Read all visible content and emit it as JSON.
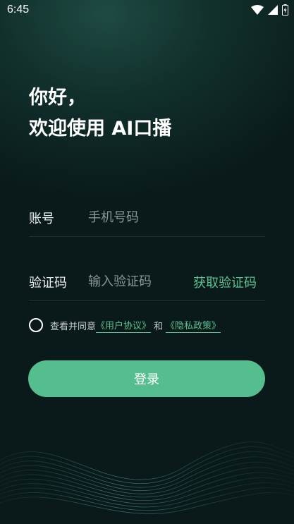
{
  "status_bar": {
    "time": "6:45"
  },
  "greeting": {
    "line1": "你好，",
    "line2": "欢迎使用 AI口播"
  },
  "account": {
    "label": "账号",
    "placeholder": "手机号码"
  },
  "code": {
    "label": "验证码",
    "placeholder": "输入验证码",
    "get_code": "获取验证码"
  },
  "agreement": {
    "prefix": "查看并同意",
    "user_agreement": "《用户协议》",
    "and": "和",
    "privacy_policy": "《隐私政策》"
  },
  "login_button": "登录",
  "colors": {
    "accent": "#56bd8e",
    "link": "#5cc090",
    "background": "#0a1a1a"
  }
}
